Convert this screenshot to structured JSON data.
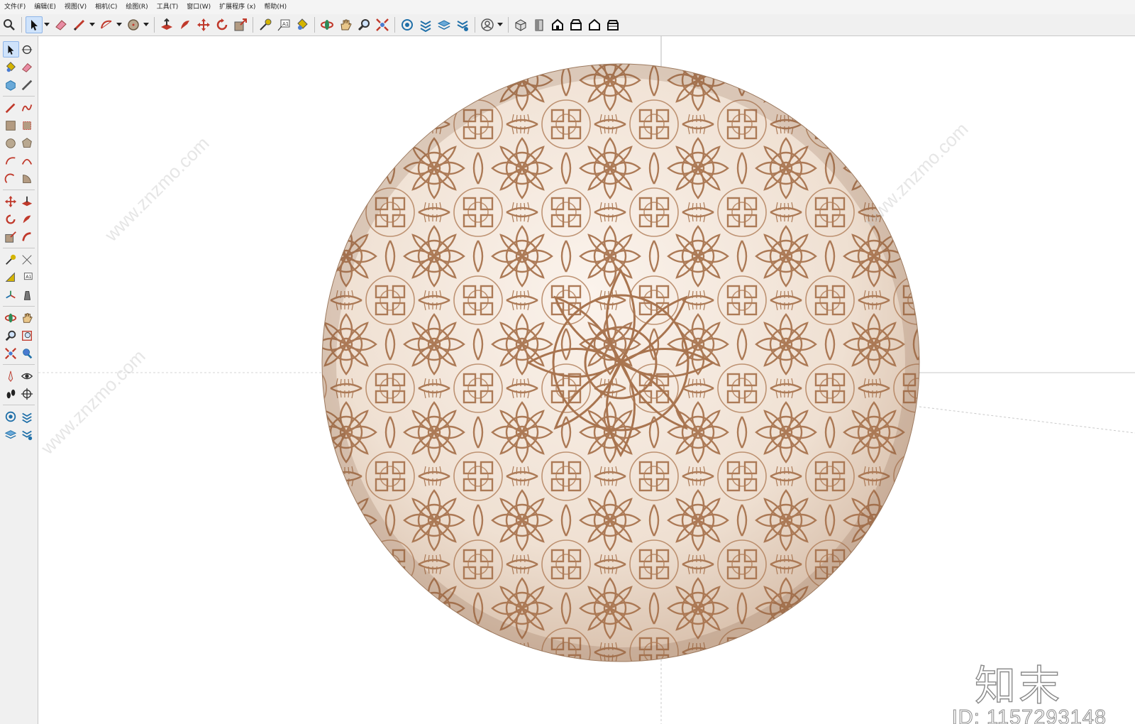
{
  "menu": [
    "文件(F)",
    "编辑(E)",
    "视图(V)",
    "相机(C)",
    "绘图(R)",
    "工具(T)",
    "窗口(W)",
    "扩展程序 (x)",
    "帮助(H)"
  ],
  "toolbar_icons": [
    "zoom-icon",
    "select-icon",
    "eraser-icon",
    "pencil-line-icon",
    "arc-icon",
    "circle-icon",
    "push-pull-icon",
    "follow-me-icon",
    "move-icon",
    "rotate-icon",
    "scale-icon",
    "tape-measure-icon",
    "text-icon",
    "paint-bucket-icon",
    "orbit-icon",
    "pan-icon",
    "zoom-glass-icon",
    "zoom-extents-icon",
    "warehouse-icon",
    "extension-warehouse-icon",
    "layers-icon",
    "styles-icon",
    "account-icon",
    "iso-view-icon",
    "top-view-icon",
    "front-view-icon",
    "right-view-icon",
    "back-view-icon",
    "left-view-icon"
  ],
  "palette_icons": [
    "select-icon",
    "orbit-icon",
    "paint-bucket-icon",
    "eraser-icon",
    "component-icon",
    "tape-icon",
    "line-icon",
    "freehand-icon",
    "rectangle-icon",
    "rotated-rectangle-icon",
    "circle-icon",
    "polygon-icon",
    "arc-icon",
    "two-point-arc-icon",
    "three-point-arc-icon",
    "pie-icon",
    "move-icon",
    "push-pull-icon",
    "rotate-icon",
    "follow-me-icon",
    "scale-icon",
    "offset-icon",
    "tape-measure-icon",
    "dimension-icon",
    "protractor-icon",
    "text-icon",
    "axes-icon",
    "3d-text-icon",
    "orbit-tool-icon",
    "pan-tool-icon",
    "zoom-tool-icon",
    "zoom-window-icon",
    "zoom-extents-icon",
    "previous-view-icon",
    "position-camera-icon",
    "look-around-icon",
    "walk-icon",
    "section-plane-icon",
    "warehouse-icon",
    "extension-warehouse-icon",
    "layer-manager-icon",
    "style-manager-icon"
  ],
  "scene": {
    "object": "sphere",
    "texture": "mandala",
    "texture_line_color": "#a8744f",
    "texture_base_color": "#f3e6da"
  },
  "watermark": {
    "brand": "知末",
    "id": "ID: 1157293148",
    "diagonal": "www.znzmo.com"
  },
  "colors": {
    "toolbar_bg": "#f0f0f0",
    "active_tool": "#cfe3fb",
    "axis_line": "#c9c9c9"
  }
}
